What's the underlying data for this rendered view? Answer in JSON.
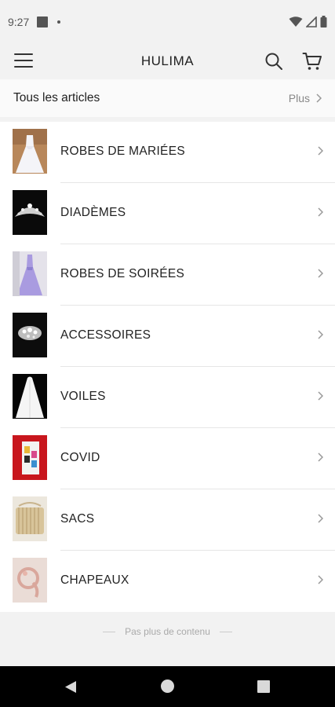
{
  "status_bar": {
    "time": "9:27"
  },
  "header": {
    "title": "HULIMA",
    "menu_icon": "menu-icon",
    "search_icon": "search-icon",
    "cart_icon": "cart-icon"
  },
  "all_articles": {
    "label": "Tous les articles",
    "more_label": "Plus"
  },
  "categories": [
    {
      "label": "ROBES DE MARIÉES",
      "thumb": "wedding-dress-thumbnail"
    },
    {
      "label": "DIADÈMES",
      "thumb": "tiara-thumbnail"
    },
    {
      "label": "ROBES DE SOIRÉES",
      "thumb": "evening-dress-thumbnail"
    },
    {
      "label": "ACCESSOIRES",
      "thumb": "accessory-thumbnail"
    },
    {
      "label": "VOILES",
      "thumb": "veil-thumbnail"
    },
    {
      "label": "COVID",
      "thumb": "covid-thumbnail"
    },
    {
      "label": "SACS",
      "thumb": "bag-thumbnail"
    },
    {
      "label": "CHAPEAUX",
      "thumb": "hat-thumbnail"
    }
  ],
  "footer": {
    "end_note": "Pas plus de contenu"
  },
  "colors": {
    "background": "#f2f2f2",
    "list_background": "#ffffff",
    "text": "#222222",
    "muted": "#888888"
  }
}
